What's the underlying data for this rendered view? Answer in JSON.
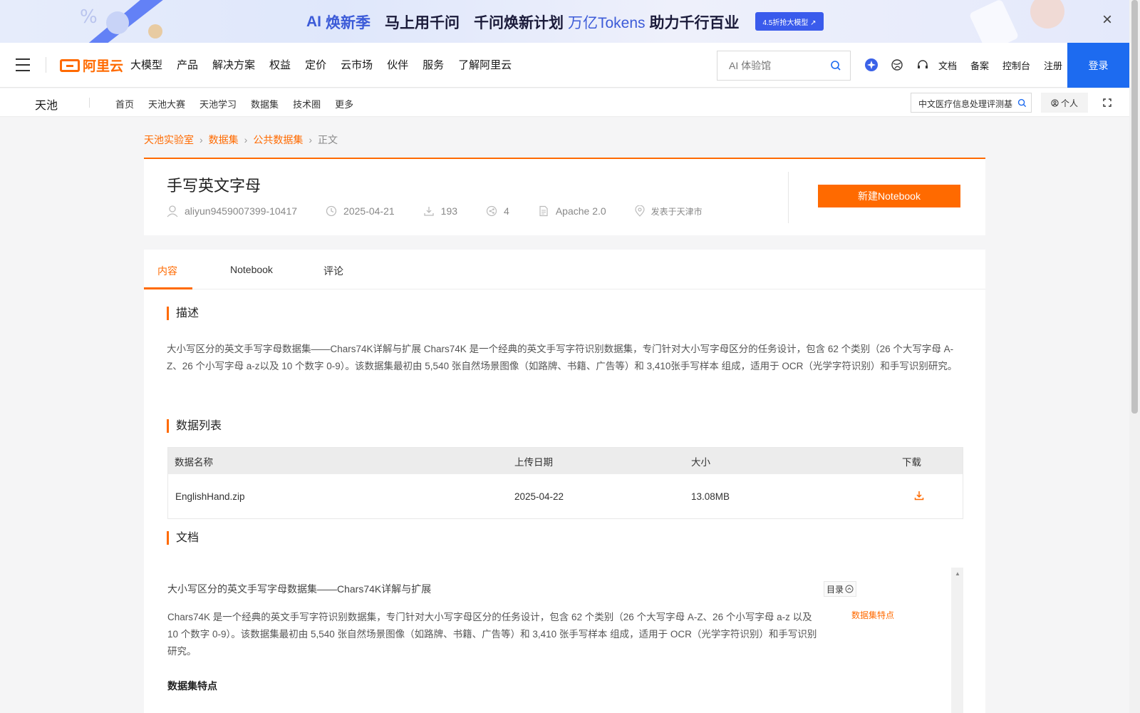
{
  "banner": {
    "ai_prefix": "AI",
    "campaign": "焕新季",
    "slogan_1": "马上用千问",
    "slogan_2": "千问焕新计划",
    "highlight": "万亿Tokens",
    "slogan_3": "助力千行百业",
    "cta": "4.5折抢大模型 ↗",
    "close": "×"
  },
  "header": {
    "logo_text": "阿里云",
    "nav": [
      "大模型",
      "产品",
      "解决方案",
      "权益",
      "定价",
      "云市场",
      "伙伴",
      "服务",
      "了解阿里云"
    ],
    "search_placeholder": "AI 体验馆",
    "links": [
      "文档",
      "备案",
      "控制台",
      "注册"
    ],
    "login": "登录"
  },
  "subheader": {
    "brand": "天池",
    "nav": [
      "首页",
      "天池大赛",
      "天池学习",
      "数据集",
      "技术圈",
      "更多"
    ],
    "search_value": "中文医疗信息处理评测基",
    "personal": "个人"
  },
  "breadcrumb": [
    "天池实验室",
    "数据集",
    "公共数据集",
    "正文"
  ],
  "dataset": {
    "title": "手写英文字母",
    "author": "aliyun9459007399-10417",
    "date": "2025-04-21",
    "downloads": "193",
    "shares": "4",
    "license": "Apache 2.0",
    "location": "发表于天津市",
    "notebook_button": "新建Notebook"
  },
  "tabs": [
    "内容",
    "Notebook",
    "评论"
  ],
  "content": {
    "desc_title": "描述",
    "desc_text": "  大小写区分的英文手写字母数据集——Chars74K详解与扩展 Chars74K 是一个经典的英文手写字符识别数据集，专门针对大小写字母区分的任务设计，包含 62 个类别（26 个大写字母 A-Z、26 个小写字母 a-z以及 10 个数字 0-9）。该数据集最初由 5,540 张自然场景图像（如路牌、书籍、广告等）和 3,410张手写样本 组成，适用于 OCR（光学字符识别）和手写识别研究。",
    "list_title": "数据列表",
    "table": {
      "headers": [
        "数据名称",
        "上传日期",
        "大小",
        "下载"
      ],
      "rows": [
        {
          "name": "EnglishHand.zip",
          "date": "2025-04-22",
          "size": "13.08MB"
        }
      ]
    },
    "doc_title": "文档",
    "doc_heading": "大小写区分的英文手写字母数据集——Chars74K详解与扩展",
    "doc_paragraph": "Chars74K 是一个经典的英文手写字符识别数据集，专门针对大小写字母区分的任务设计，包含 62 个类别（26 个大写字母 A-Z、26 个小写字母 a-z 以及 10 个数字 0-9）。该数据集最初由 5,540 张自然场景图像（如路牌、书籍、广告等）和 3,410 张手写样本 组成，适用于 OCR（光学字符识别）和手写识别研究。",
    "doc_bold": "数据集特点",
    "toc_label": "目录",
    "toc_item": "数据集特点"
  },
  "colors": {
    "accent": "#ff6a00",
    "login_blue": "#1d6bf0",
    "banner_blue": "#3a5bec"
  }
}
